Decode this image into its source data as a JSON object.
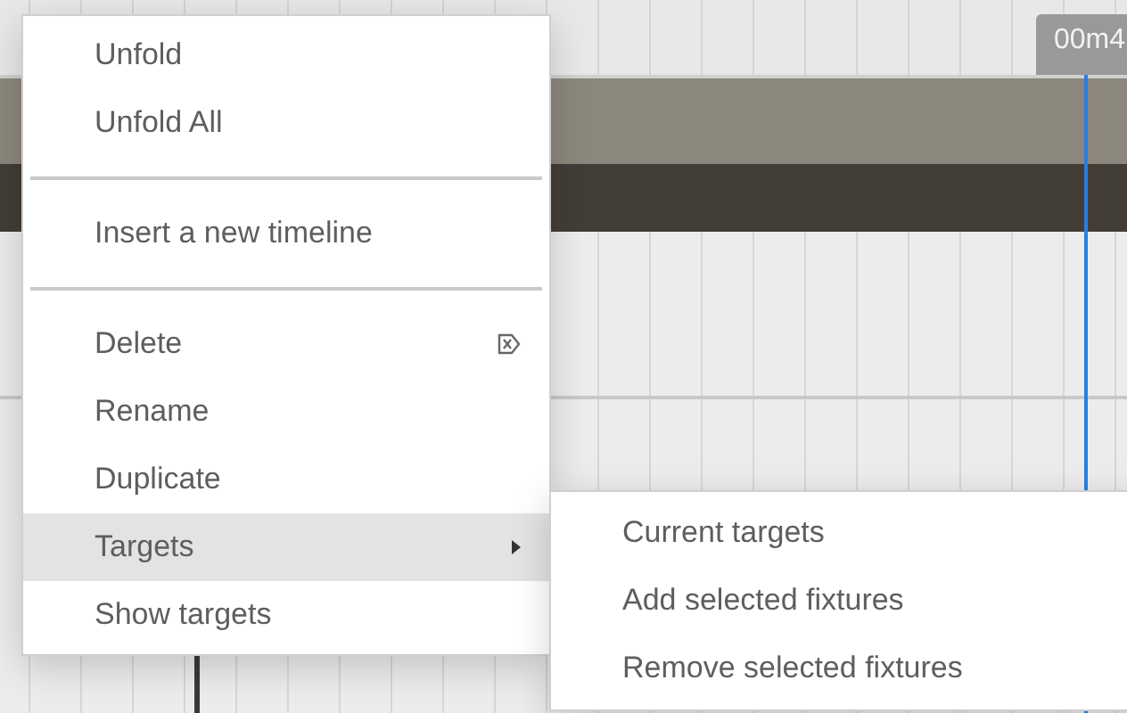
{
  "timeline": {
    "time_label": "00m4"
  },
  "context_menu": {
    "items": [
      {
        "kind": "item",
        "label": "Unfold",
        "selected": false
      },
      {
        "kind": "item",
        "label": "Unfold All",
        "selected": false
      },
      {
        "kind": "separator"
      },
      {
        "kind": "item",
        "label": "Insert a new timeline",
        "selected": false
      },
      {
        "kind": "separator"
      },
      {
        "kind": "item",
        "label": "Delete",
        "selected": false,
        "has_icon": true
      },
      {
        "kind": "item",
        "label": "Rename",
        "selected": false
      },
      {
        "kind": "item",
        "label": "Duplicate",
        "selected": false
      },
      {
        "kind": "item",
        "label": "Targets",
        "selected": true,
        "has_submenu": true
      },
      {
        "kind": "item",
        "label": "Show targets",
        "selected": false
      }
    ]
  },
  "submenu": {
    "items": [
      {
        "label": "Current targets",
        "selected": false
      },
      {
        "label": "Add selected fixtures",
        "selected": false
      },
      {
        "label": "Remove selected fixtures",
        "selected": false
      }
    ]
  }
}
